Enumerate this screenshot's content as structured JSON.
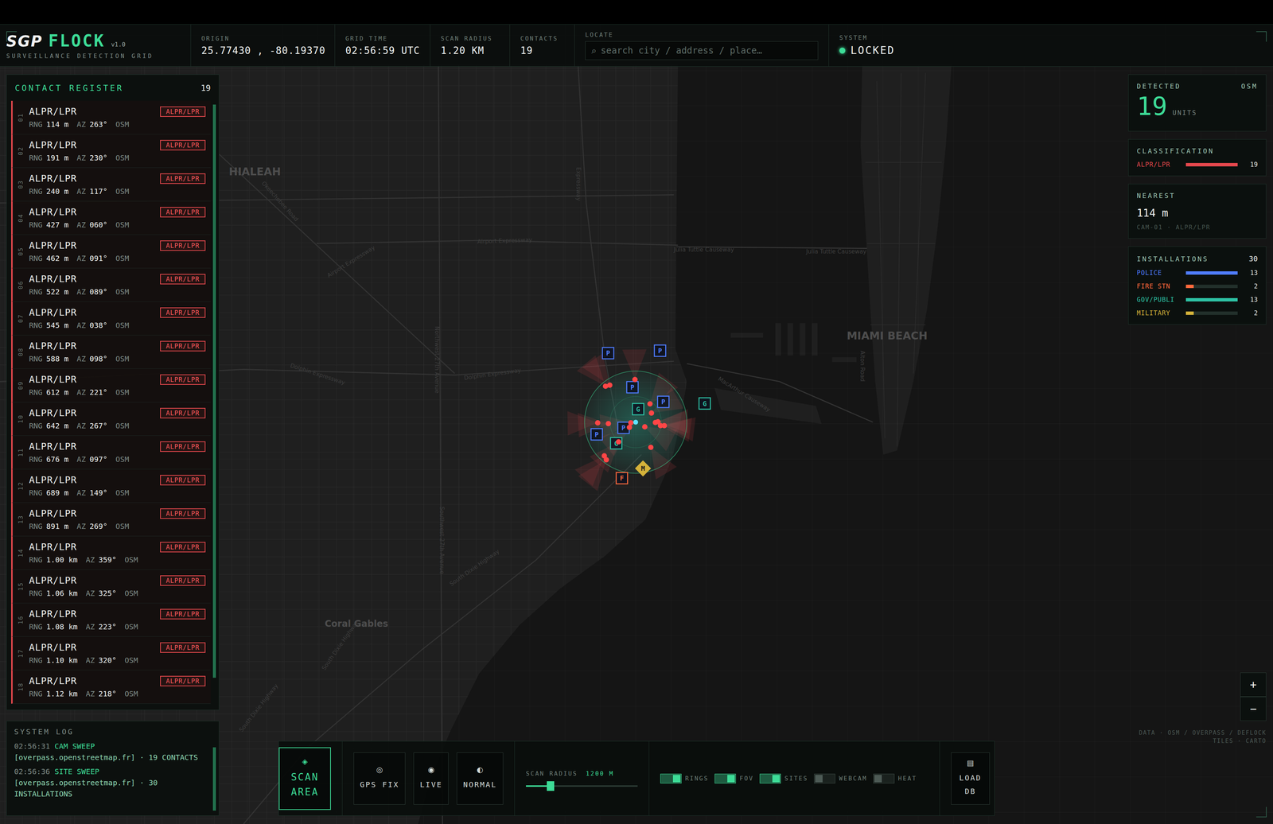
{
  "header": {
    "logo": {
      "mark": "SGP",
      "name": "FLOCK",
      "version": "v1.0",
      "subtitle": "SURVEILLANCE DETECTION GRID"
    },
    "fields": [
      {
        "label": "ORIGIN",
        "value": "25.77430 , -80.19370"
      },
      {
        "label": "GRID TIME",
        "value": "02:56:59 UTC"
      },
      {
        "label": "SCAN RADIUS",
        "value": "1.20 KM"
      },
      {
        "label": "CONTACTS",
        "value": "19"
      }
    ],
    "locate": {
      "label": "LOCATE",
      "icon": "⌕",
      "placeholder": "search city / address / place…"
    },
    "system": {
      "label": "SYSTEM",
      "value": "LOCKED",
      "on": true
    }
  },
  "contact_register": {
    "title": "CONTACT REGISTER",
    "count": "19",
    "range_label": "RNG",
    "azimuth_label": "AZ",
    "contacts": [
      {
        "number": "01",
        "type": "ALPR/LPR",
        "badge": "ALPR/LPR",
        "range": "114 m",
        "azimuth": "263°",
        "source": "OSM"
      },
      {
        "number": "02",
        "type": "ALPR/LPR",
        "badge": "ALPR/LPR",
        "range": "191 m",
        "azimuth": "230°",
        "source": "OSM"
      },
      {
        "number": "03",
        "type": "ALPR/LPR",
        "badge": "ALPR/LPR",
        "range": "240 m",
        "azimuth": "117°",
        "source": "OSM"
      },
      {
        "number": "04",
        "type": "ALPR/LPR",
        "badge": "ALPR/LPR",
        "range": "427 m",
        "azimuth": "060°",
        "source": "OSM"
      },
      {
        "number": "05",
        "type": "ALPR/LPR",
        "badge": "ALPR/LPR",
        "range": "462 m",
        "azimuth": "091°",
        "source": "OSM"
      },
      {
        "number": "06",
        "type": "ALPR/LPR",
        "badge": "ALPR/LPR",
        "range": "522 m",
        "azimuth": "089°",
        "source": "OSM"
      },
      {
        "number": "07",
        "type": "ALPR/LPR",
        "badge": "ALPR/LPR",
        "range": "545 m",
        "azimuth": "038°",
        "source": "OSM"
      },
      {
        "number": "08",
        "type": "ALPR/LPR",
        "badge": "ALPR/LPR",
        "range": "588 m",
        "azimuth": "098°",
        "source": "OSM"
      },
      {
        "number": "09",
        "type": "ALPR/LPR",
        "badge": "ALPR/LPR",
        "range": "612 m",
        "azimuth": "221°",
        "source": "OSM"
      },
      {
        "number": "10",
        "type": "ALPR/LPR",
        "badge": "ALPR/LPR",
        "range": "642 m",
        "azimuth": "267°",
        "source": "OSM"
      },
      {
        "number": "11",
        "type": "ALPR/LPR",
        "badge": "ALPR/LPR",
        "range": "676 m",
        "azimuth": "097°",
        "source": "OSM"
      },
      {
        "number": "12",
        "type": "ALPR/LPR",
        "badge": "ALPR/LPR",
        "range": "689 m",
        "azimuth": "149°",
        "source": "OSM"
      },
      {
        "number": "13",
        "type": "ALPR/LPR",
        "badge": "ALPR/LPR",
        "range": "891 m",
        "azimuth": "269°",
        "source": "OSM"
      },
      {
        "number": "14",
        "type": "ALPR/LPR",
        "badge": "ALPR/LPR",
        "range": "1.00 km",
        "azimuth": "359°",
        "source": "OSM"
      },
      {
        "number": "15",
        "type": "ALPR/LPR",
        "badge": "ALPR/LPR",
        "range": "1.06 km",
        "azimuth": "325°",
        "source": "OSM"
      },
      {
        "number": "16",
        "type": "ALPR/LPR",
        "badge": "ALPR/LPR",
        "range": "1.08 km",
        "azimuth": "223°",
        "source": "OSM"
      },
      {
        "number": "17",
        "type": "ALPR/LPR",
        "badge": "ALPR/LPR",
        "range": "1.10 km",
        "azimuth": "320°",
        "source": "OSM"
      },
      {
        "number": "18",
        "type": "ALPR/LPR",
        "badge": "ALPR/LPR",
        "range": "1.12 km",
        "azimuth": "218°",
        "source": "OSM"
      }
    ]
  },
  "system_log": {
    "title": "SYSTEM LOG",
    "entries": [
      {
        "time": "02:56:31",
        "action": "CAM SWEEP",
        "detail": "[overpass.openstreetmap.fr] · 19 CONTACTS"
      },
      {
        "time": "02:56:36",
        "action": "SITE SWEEP",
        "detail": "[overpass.openstreetmap.fr] · 30 INSTALLATIONS"
      }
    ]
  },
  "summary": {
    "detected": {
      "label": "DETECTED",
      "source": "OSM",
      "value": "19",
      "unit": "UNITS"
    },
    "classification": {
      "label": "CLASSIFICATION",
      "items": [
        {
          "name": "ALPR/LPR",
          "count": "19",
          "level": 1.0,
          "color": "#e5484d"
        }
      ]
    },
    "nearest": {
      "label": "NEAREST",
      "value": "114 m",
      "detail": "CAM-01 · ALPR/LPR"
    },
    "installations": {
      "label": "INSTALLATIONS",
      "total": "30",
      "items": [
        {
          "name": "POLICE",
          "count": "13",
          "level": 1.0,
          "color": "#4f7cff"
        },
        {
          "name": "FIRE STN",
          "count": "2",
          "level": 0.15,
          "color": "#ff6a3d"
        },
        {
          "name": "GOV/PUBLI",
          "count": "13",
          "level": 1.0,
          "color": "#2ec4a6"
        },
        {
          "name": "MILITARY",
          "count": "2",
          "level": 0.15,
          "color": "#d4b23a"
        }
      ]
    }
  },
  "zoom": {
    "zoom_in": "+",
    "zoom_out": "−"
  },
  "attribution": [
    "DATA · OSM / OVERPASS / DEFLOCK",
    "TILES · CARTO"
  ],
  "toolbar": {
    "buttons": [
      {
        "icon": "◈",
        "label": "SCAN AREA",
        "kind": "primary"
      },
      {
        "icon": "◎",
        "label": "GPS FIX",
        "kind": "plain"
      },
      {
        "icon": "◉",
        "label": "LIVE",
        "kind": "plain"
      },
      {
        "icon": "◐",
        "label": "NORMAL",
        "kind": "plain"
      }
    ],
    "slider": {
      "label": "SCAN RADIUS",
      "reading": "1200 M",
      "level": 0.22
    },
    "toggles": [
      {
        "label": "RINGS",
        "on": true
      },
      {
        "label": "FOV",
        "on": true
      },
      {
        "label": "SITES",
        "on": true
      },
      {
        "label": "WEBCAM",
        "on": false
      },
      {
        "label": "HEAT",
        "on": false
      }
    ],
    "load": {
      "icon": "▤",
      "label": "LOAD DB"
    }
  },
  "map": {
    "labels": [
      "HIALEAH",
      "MIAMI BEACH",
      "Coral Gables",
      "Airport Expressway",
      "Airport Expressway",
      "Dolphin Expressway",
      "Dolphin Expressway",
      "Julia Tuttle Causeway",
      "Julia Tuttle Causeway",
      "MacArthur Causeway",
      "Okeechobee Road",
      "Northwest 27th Avenue",
      "Southwest 27th Avenue",
      "South Dixie Highway",
      "South Dixie Highway",
      "South Dixie Highway",
      "Expressway",
      "Alton Road"
    ],
    "sites": [
      {
        "label": "P",
        "color": "#4f7cff",
        "kind": "square"
      },
      {
        "label": "P",
        "color": "#4f7cff",
        "kind": "square"
      },
      {
        "label": "P",
        "color": "#4f7cff",
        "kind": "square"
      },
      {
        "label": "P",
        "color": "#4f7cff",
        "kind": "square"
      },
      {
        "label": "G",
        "color": "#2ec4a6",
        "kind": "square"
      },
      {
        "label": "P",
        "color": "#4f7cff",
        "kind": "square"
      },
      {
        "label": "F",
        "color": "#ff6a3d",
        "kind": "square"
      },
      {
        "label": "M",
        "color": "#d4b23a",
        "kind": "diamond"
      },
      {
        "label": "G",
        "color": "#2ec4a6",
        "kind": "square"
      },
      {
        "label": "G",
        "color": "#2ec4a6",
        "kind": "square"
      },
      {
        "label": "P",
        "color": "#4f7cff",
        "kind": "square"
      }
    ]
  }
}
